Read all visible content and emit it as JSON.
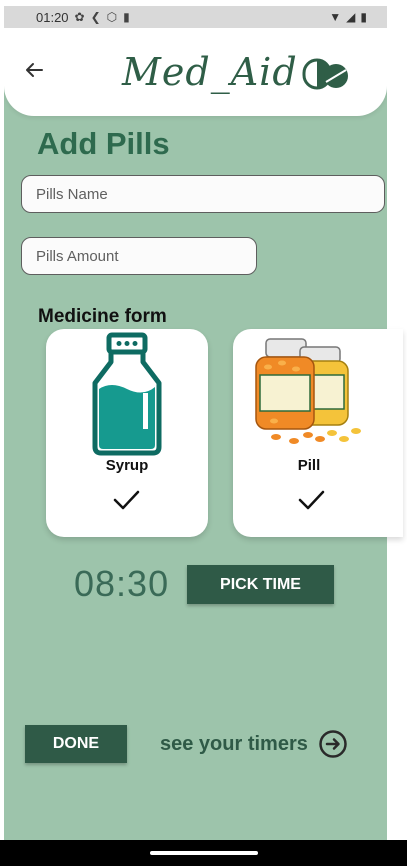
{
  "status_bar": {
    "time": "01:20"
  },
  "header": {
    "logo_text": "Med_Aid"
  },
  "page": {
    "title": "Add Pills"
  },
  "fields": {
    "pills_name_placeholder": "Pills Name",
    "pills_amount_placeholder": "Pills Amount"
  },
  "medicine_form": {
    "label": "Medicine form",
    "options": [
      {
        "label": "Syrup"
      },
      {
        "label": "Pill"
      }
    ]
  },
  "time": {
    "value": "08:30",
    "pick_label": "PICK TIME"
  },
  "footer": {
    "done_label": "DONE",
    "timers_link": "see your timers"
  },
  "colors": {
    "background": "#9dc4ab",
    "accent": "#2f5a47",
    "title": "#2e6a4e"
  }
}
